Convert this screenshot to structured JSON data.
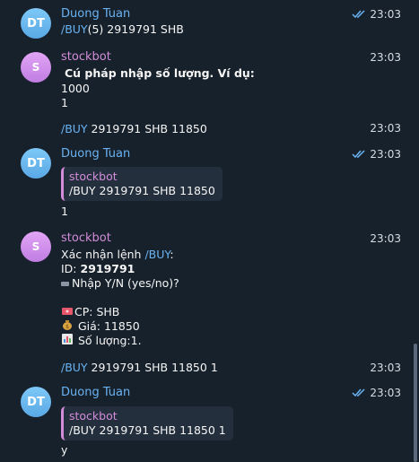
{
  "messages": [
    {
      "sender": "Duong Tuan",
      "avatar": "DT",
      "time": "23:03",
      "command": "/BUY",
      "text_rest": "(5) 2919791 SHB"
    },
    {
      "sender": "stockbot",
      "avatar": "S",
      "time": "23:03",
      "line1": "Cú pháp nhập số lượng. Ví dụ:",
      "line2": "1000",
      "line3": "1"
    },
    {
      "time": "23:03",
      "command": "/BUY",
      "text_rest": " 2919791 SHB 11850"
    },
    {
      "sender": "Duong Tuan",
      "avatar": "DT",
      "time": "23:03",
      "reply_name": "stockbot",
      "reply_text": "/BUY 2919791 SHB 11850",
      "text": "1"
    },
    {
      "sender": "stockbot",
      "avatar": "S",
      "time": "23:03",
      "confirm_prefix": "Xác nhận lệnh ",
      "confirm_cmd": "/BUY",
      "confirm_suffix": ":",
      "id_label": "ID: ",
      "id_value": "2919791",
      "prompt": "Nhập Y/N (yes/no)?",
      "cp": "CP: SHB",
      "gia": " Giá: 11850",
      "so_luong": " Số lượng:1."
    },
    {
      "time": "23:03",
      "command": "/BUY",
      "text_rest": " 2919791 SHB 11850 1"
    },
    {
      "sender": "Duong Tuan",
      "avatar": "DT",
      "time": "23:03",
      "reply_name": "stockbot",
      "reply_text": "/BUY 2919791 SHB 11850 1",
      "text": "y"
    }
  ],
  "icons": {
    "read_receipt": "double-check-icon",
    "ticket": "ticket-icon",
    "money_bag": "money-bag-icon",
    "chart": "bar-chart-icon",
    "keyboard": "keyboard-icon"
  },
  "colors": {
    "background": "#17212b",
    "link_blue": "#6ab3f3",
    "bot_pink": "#d28cd9",
    "reply_bg": "#242f3d"
  }
}
